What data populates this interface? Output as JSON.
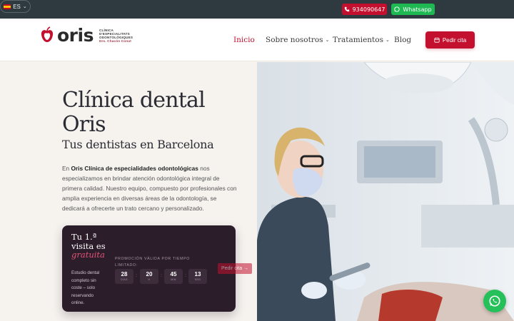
{
  "topbar": {
    "phone": "934090647",
    "whatsapp": "Whatsapp",
    "language": "ES"
  },
  "header": {
    "logo_word": "oris",
    "logo_sub": [
      "CLÍNICA",
      "D'ESPECIALITATS",
      "ODONTOLÒGIQUES",
      "Drs. Chacón Conut"
    ],
    "nav": [
      {
        "label": "Inicio",
        "active": true
      },
      {
        "label": "Sobre nosotros",
        "dropdown": true
      },
      {
        "label": "Tratamientos",
        "dropdown": true
      },
      {
        "label": "Blog"
      }
    ],
    "cta": "Pedir cita"
  },
  "hero": {
    "title": "Clínica dental Oris",
    "subtitle": "Tus dentistas en Barcelona",
    "para_prefix": "En ",
    "para_bold": "Oris Clínica de especialidades odontológicas",
    "para_rest": " nos especializamos en brindar atención odontológica integral de primera calidad. Nuestro equipo, compuesto por profesionales con amplia experiencia en diversas áreas de la odontología, se dedicará a ofrecerte un trato cercano y personalizado."
  },
  "promo": {
    "title_line": "Tu 1.ª visita es",
    "title_highlight": "gratuita",
    "description": "Estudio dental completo sin coste – solo reservando online.",
    "label": "PROMOCIÓN VÁLIDA POR TIEMPO LIMITADO:",
    "countdown": [
      {
        "value": "28",
        "unit": "DÍAS"
      },
      {
        "value": "20",
        "unit": "H"
      },
      {
        "value": "45",
        "unit": "MIN"
      },
      {
        "value": "13",
        "unit": "SEG"
      }
    ],
    "cta": "Pedir cita →"
  },
  "colors": {
    "brand_red": "#c3102e",
    "whatsapp_green": "#1fb954",
    "dark_card": "#2c1d2b",
    "topbar_bg": "#2f3a40"
  },
  "icons": [
    "phone-icon",
    "whatsapp-icon",
    "flag-es-icon",
    "calendar-icon",
    "oris-logo-mark",
    "whatsapp-float-icon"
  ]
}
